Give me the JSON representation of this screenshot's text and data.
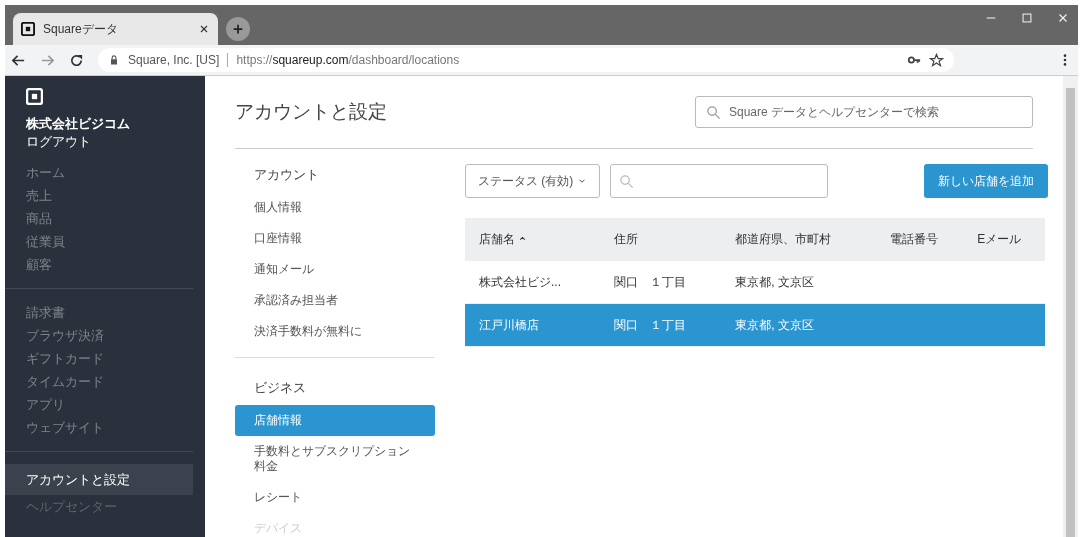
{
  "browser": {
    "tab_title": "Squareデータ",
    "site_identity": "Square, Inc. [US]",
    "url_scheme": "https://",
    "url_host": "squareup.com",
    "url_path": "/dashboard/locations"
  },
  "sidebar": {
    "company": "株式会社ビジコム",
    "logout": "ログアウト",
    "groups": [
      [
        {
          "label": "ホーム",
          "selected": false
        },
        {
          "label": "売上",
          "selected": false
        },
        {
          "label": "商品",
          "selected": false
        },
        {
          "label": "従業員",
          "selected": false
        },
        {
          "label": "顧客",
          "selected": false
        }
      ],
      [
        {
          "label": "請求書",
          "selected": false
        },
        {
          "label": "ブラウザ決済",
          "selected": false
        },
        {
          "label": "ギフトカード",
          "selected": false
        },
        {
          "label": "タイムカード",
          "selected": false
        },
        {
          "label": "アプリ",
          "selected": false
        },
        {
          "label": "ウェブサイト",
          "selected": false
        }
      ],
      [
        {
          "label": "アカウントと設定",
          "selected": true
        },
        {
          "label": "ヘルプセンター",
          "selected": false
        }
      ]
    ]
  },
  "page": {
    "title": "アカウントと設定",
    "search": {
      "placeholder": "Square データとヘルプセンターで検索"
    }
  },
  "settings_nav": [
    {
      "heading": "アカウント",
      "items": [
        {
          "label": "個人情報",
          "selected": false
        },
        {
          "label": "口座情報",
          "selected": false
        },
        {
          "label": "通知メール",
          "selected": false
        },
        {
          "label": "承認済み担当者",
          "selected": false
        },
        {
          "label": "決済手数料が無料に",
          "selected": false
        }
      ]
    },
    {
      "heading": "ビジネス",
      "items": [
        {
          "label": "店舗情報",
          "selected": true
        },
        {
          "label": "手数料とサブスクリプション料金",
          "selected": false
        },
        {
          "label": "レシート",
          "selected": false
        },
        {
          "label": "デバイス",
          "selected": false
        }
      ]
    }
  ],
  "toolbar": {
    "status_filter": "ステータス (有効)",
    "add_button": "新しい店舗を追加"
  },
  "table": {
    "columns": [
      {
        "label": "店舗名",
        "sorted_ascending": true
      },
      {
        "label": "住所",
        "sorted_ascending": false
      },
      {
        "label": "都道府県、市町村",
        "sorted_ascending": false
      },
      {
        "label": "電話番号",
        "sorted_ascending": false
      },
      {
        "label": "Eメール",
        "sorted_ascending": false
      }
    ],
    "rows": [
      {
        "selected": false,
        "cells": [
          "株式会社ビジ...",
          "関口　１丁目",
          "東京都, 文京区",
          "",
          ""
        ]
      },
      {
        "selected": true,
        "cells": [
          "江戸川橋店",
          "関口　１丁目",
          "東京都, 文京区",
          "",
          ""
        ]
      }
    ]
  }
}
